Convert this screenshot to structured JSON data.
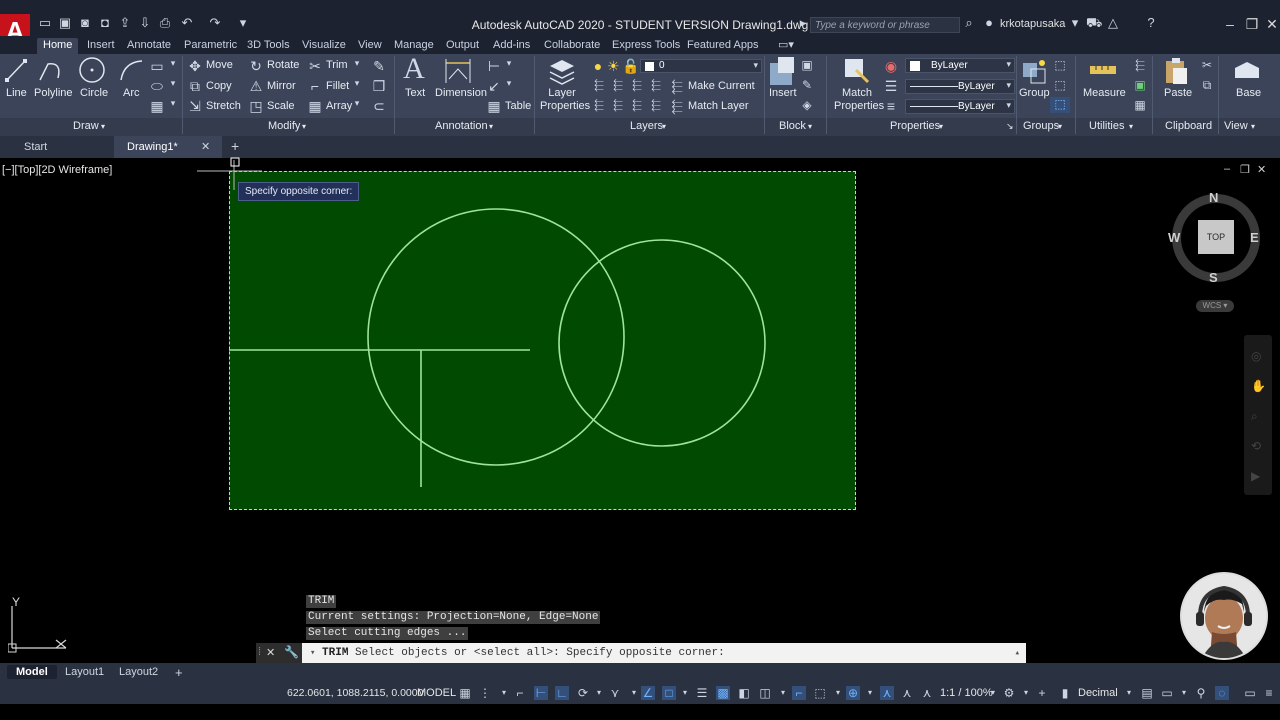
{
  "app": {
    "logo": "A",
    "title": "Autodesk AutoCAD 2020 - STUDENT VERSION    Drawing1.dwg"
  },
  "titlebar": {
    "search_placeholder": "Type a keyword or phrase",
    "user": "krkotapusaka"
  },
  "ribbon_tabs": [
    "Home",
    "Insert",
    "Annotate",
    "Parametric",
    "3D Tools",
    "Visualize",
    "View",
    "Manage",
    "Output",
    "Add-ins",
    "Collaborate",
    "Express Tools",
    "Featured Apps"
  ],
  "draw": {
    "line": "Line",
    "polyline": "Polyline",
    "circle": "Circle",
    "arc": "Arc",
    "panel": "Draw"
  },
  "modify": {
    "move": "Move",
    "rotate": "Rotate",
    "trim": "Trim",
    "copy": "Copy",
    "mirror": "Mirror",
    "fillet": "Fillet",
    "stretch": "Stretch",
    "scale": "Scale",
    "array": "Array",
    "panel": "Modify"
  },
  "annotation": {
    "text": "Text",
    "dimension": "Dimension",
    "table": "Table",
    "panel": "Annotation"
  },
  "layers": {
    "layer_properties": "Layer\nProperties",
    "current_layer": "0",
    "make_current": "Make Current",
    "match_layer": "Match Layer",
    "panel": "Layers"
  },
  "block": {
    "insert": "Insert",
    "panel": "Block"
  },
  "properties": {
    "match_properties": "Match\nProperties",
    "color": "ByLayer",
    "linetype": "ByLayer",
    "lineweight": "ByLayer",
    "panel": "Properties"
  },
  "groups": {
    "group": "Group",
    "panel": "Groups"
  },
  "utilities": {
    "measure": "Measure",
    "panel": "Utilities"
  },
  "clipboard": {
    "paste": "Paste",
    "panel": "Clipboard"
  },
  "view": {
    "base": "Base",
    "panel": "View"
  },
  "file_tabs": {
    "start": "Start",
    "drawing": "Drawing1*",
    "close": "✕",
    "add": "+"
  },
  "viewport": {
    "label": "[−][Top][2D Wireframe]",
    "tooltip": "Specify opposite corner:"
  },
  "viewcube": {
    "n": "N",
    "s": "S",
    "e": "E",
    "w": "W",
    "top": "TOP",
    "wcs": "WCS ▾"
  },
  "ucs": {
    "y": "Y"
  },
  "command": {
    "history": [
      "TRIM",
      "Current settings: Projection=None, Edge=None",
      "Select cutting edges ..."
    ],
    "prompt_cmd": "TRIM",
    "prompt_text": "Select objects or <select all>: Specify opposite corner:"
  },
  "layout_tabs": [
    "Model",
    "Layout1",
    "Layout2"
  ],
  "layout_add": "+",
  "status": {
    "coords": "622.0601, 1088.2115, 0.0000",
    "mode": "MODEL",
    "scale": "1:1 / 100%",
    "units": "Decimal"
  }
}
